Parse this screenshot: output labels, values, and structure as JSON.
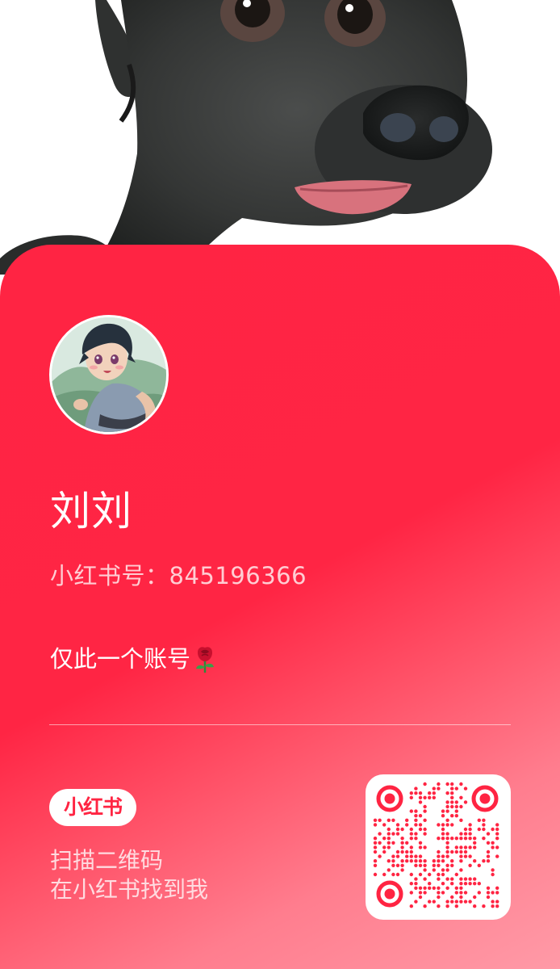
{
  "profile": {
    "name": "刘刘",
    "account_id": "小红书号：845196366",
    "bio": "仅此一个账号"
  },
  "icons": {
    "avatar": "anime-boy-avatar",
    "bio_emoji": "rose-icon",
    "qr": "qr-code-icon"
  },
  "brand": {
    "logo_text": "小红书",
    "color": "#ff2442"
  },
  "scan_tip": {
    "line1": "扫描二维码",
    "line2": "在小红书找到我"
  },
  "colors": {
    "card_top": "#ff2443",
    "card_bottom": "#ff9aa7",
    "text_primary": "#ffffff"
  }
}
